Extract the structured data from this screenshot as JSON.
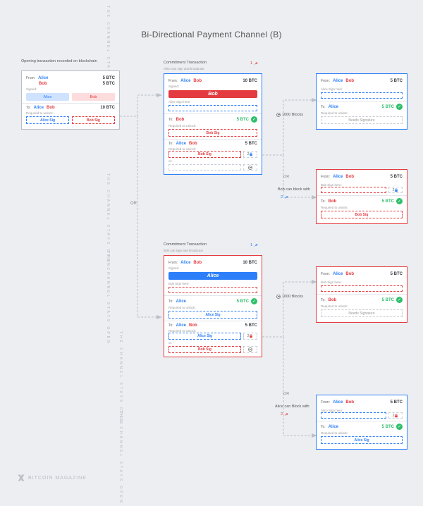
{
  "title": "Bi-Directional Payment Channel (B)",
  "meta_open": "THE CHANNEL STAYS OPEN",
  "logo": "BITCOIN MAGAZINE",
  "names": {
    "alice": "Alice",
    "bob": "Bob"
  },
  "labels": {
    "from": "From:",
    "to": "To:",
    "signed": "Signed:",
    "req": "Required to unlock:",
    "req2": "Required to Unlock:",
    "sign_here_a": "Alice Sign here:",
    "sign_here_b": "Bob Sign here:",
    "alice_sig": "Alice Sig",
    "bob_sig": "Bob Sig",
    "or": "OR",
    "or_lc": "or:",
    "needs_sig": "Needs Signature",
    "bob_block": "Bob can block with",
    "alice_block": "Alice can Block with"
  },
  "amounts": {
    "five": "5 BTC",
    "ten": "10 BTC",
    "two": "2"
  },
  "timing": {
    "blocks1": "1000 Blocks",
    "blocks2": "1000 Blocks"
  },
  "key_nums": {
    "one": "1",
    "two": "2"
  },
  "sections": {
    "open": {
      "title": "Opening transaction recorded on blockchain"
    },
    "commit_a": {
      "title": "Commitment Transaction",
      "sub": "Alice can sign and broadcast"
    },
    "commit_b": {
      "title": "Commitment Transaction",
      "sub": "Bob can sign and broadcast"
    }
  }
}
